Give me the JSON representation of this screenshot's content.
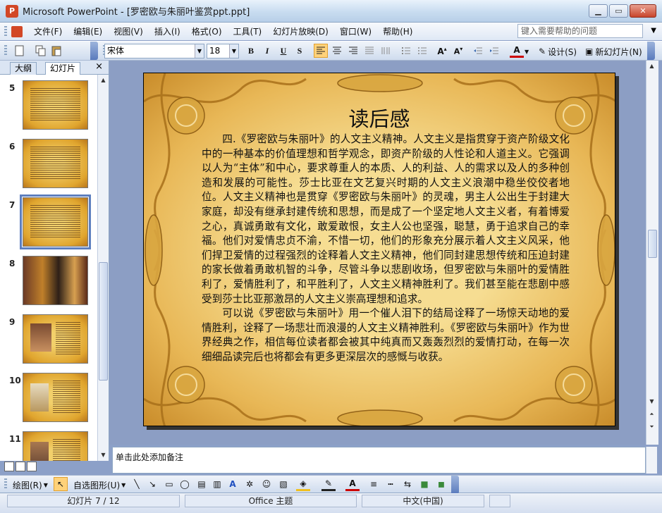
{
  "window": {
    "title": "Microsoft PowerPoint - [罗密欧与朱丽叶鉴赏ppt.ppt]",
    "min_icon": "minimize-icon",
    "max_icon": "maximize-icon",
    "close_icon": "close-icon"
  },
  "menu": {
    "items": [
      "文件(F)",
      "编辑(E)",
      "视图(V)",
      "插入(I)",
      "格式(O)",
      "工具(T)",
      "幻灯片放映(D)",
      "窗口(W)",
      "帮助(H)"
    ],
    "help_placeholder": "键入需要帮助的问题"
  },
  "format_toolbar": {
    "font": "宋体",
    "size": "18",
    "bold": "B",
    "italic": "I",
    "underline": "U",
    "shadow": "S",
    "design": "设计(S)",
    "new_slide": "新幻灯片(N)"
  },
  "left_pane": {
    "tabs": [
      "大纲",
      "幻灯片"
    ],
    "active_tab": "幻灯片",
    "close": "×",
    "thumbnails": [
      {
        "num": "5",
        "style": "parchment"
      },
      {
        "num": "6",
        "style": "parchment"
      },
      {
        "num": "7",
        "style": "parchment",
        "selected": true
      },
      {
        "num": "8",
        "style": "photo"
      },
      {
        "num": "9",
        "style": "parchment-photo"
      },
      {
        "num": "10",
        "style": "parchment-photo"
      },
      {
        "num": "11",
        "style": "parchment-photo"
      }
    ]
  },
  "slide": {
    "title": "读后感",
    "paragraph1": "四.《罗密欧与朱丽叶》的人文主义精神。人文主义是指贯穿于资产阶级文化中的一种基本的价值理想和哲学观念，即资产阶级的人性论和人道主义。它强调以人为“主体”和中心，要求尊重人的本质、人的利益、人的需求以及人的多种创造和发展的可能性。莎士比亚在文艺复兴时期的人文主义浪潮中稳坐佼佼者地位。人文主义精神也是贯穿《罗密欧与朱丽叶》的灵魂，男主人公出生于封建大家庭，却没有继承封建传统和思想，而是成了一个坚定地人文主义者，有着博爱之心，真诚勇敢有文化，敢爱敢恨，女主人公也坚强，聪慧，勇于追求自己的幸福。他们对爱情忠贞不渝，不惜一切，他们的形象充分展示着人文主义风采，他们捍卫爱情的过程强烈的诠释着人文主义精神，他们同封建思想传统和压迫封建的家长做着勇敢机智的斗争，尽管斗争以悲剧收场，但罗密欧与朱丽叶的爱情胜利了，爱情胜利了，和平胜利了，人文主义精神胜利了。我们甚至能在悲剧中感受到莎士比亚那激昂的人文主义崇高理想和追求。",
    "paragraph2": "可以说《罗密欧与朱丽叶》用一个催人泪下的结局诠释了一场惊天动地的爱情胜利，诠释了一场悲壮而浪漫的人文主义精神胜利。《罗密欧与朱丽叶》作为世界经典之作，相信每位读者都会被其中纯真而又轰轰烈烈的爱情打动，在每一次细细品读完后也将都会有更多更深层次的感慨与收获。"
  },
  "notes": {
    "placeholder": "单击此处添加备注"
  },
  "drawing_toolbar": {
    "draw": "绘图(R)",
    "autoshapes": "自选图形(U)"
  },
  "status": {
    "slide": "幻灯片 7 / 12",
    "theme": "Office 主题",
    "language": "中文(中国)"
  }
}
